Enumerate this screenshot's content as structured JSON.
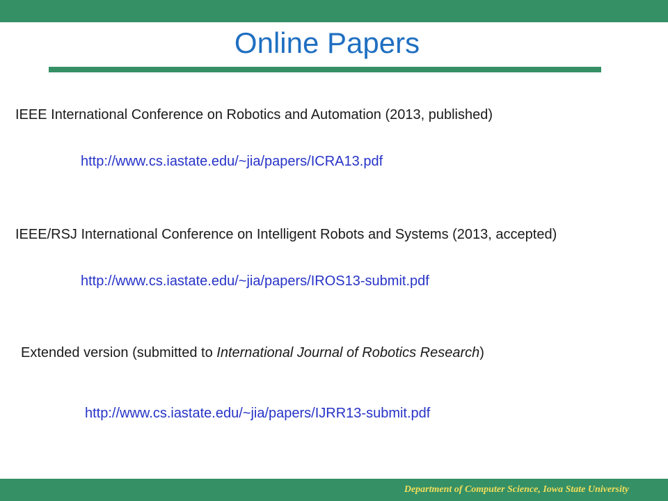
{
  "slide": {
    "title": "Online Papers",
    "entries": [
      {
        "heading": "IEEE International Conference on Robotics and Automation (2013, published)",
        "link": "http://www.cs.iastate.edu/~jia/papers/ICRA13.pdf"
      },
      {
        "heading": "IEEE/RSJ International Conference on Intelligent Robots and Systems (2013, accepted)",
        "link": "http://www.cs.iastate.edu/~jia/papers/IROS13-submit.pdf"
      },
      {
        "heading_prefix": "Extended version (submitted to ",
        "heading_italic": "International Journal of Robotics Research",
        "heading_suffix": ")",
        "link": "http://www.cs.iastate.edu/~jia/papers/IJRR13-submit.pdf"
      }
    ]
  },
  "footer": {
    "text": "Department of Computer Science, Iowa State University"
  },
  "colors": {
    "band_green": "#359066",
    "title_blue": "#1F6FC1",
    "link_blue": "#2733C7",
    "footer_text": "#F2DE5A"
  }
}
